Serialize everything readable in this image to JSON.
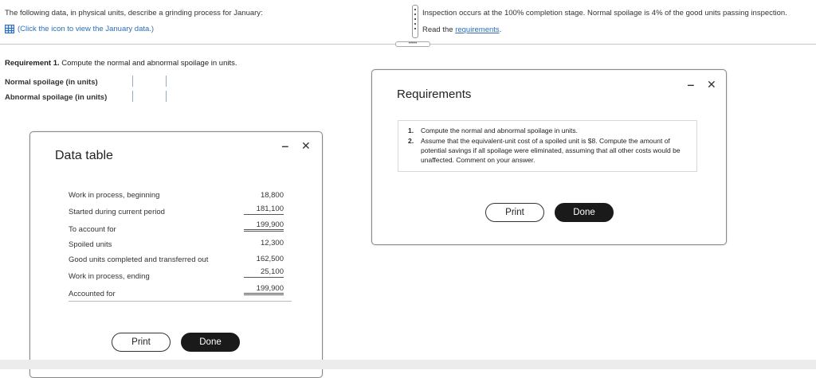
{
  "problem": {
    "intro": "The following data, in physical units, describe a grinding process for January:",
    "data_link": "(Click the icon to view the January data.)",
    "inspection": "Inspection occurs at the 100% completion stage. Normal spoilage is 4% of the good units passing inspection.",
    "read_prefix": "Read the ",
    "read_link": "requirements",
    "read_suffix": "."
  },
  "requirement1": {
    "label": "Requirement 1.",
    "text": " Compute the normal and abnormal spoilage in units.",
    "normal_label": "Normal spoilage (in units)",
    "abnormal_label": "Abnormal spoilage (in units)",
    "normal_value": "",
    "abnormal_value": ""
  },
  "data_table": {
    "title": "Data table",
    "rows": [
      {
        "label": "Work in process, beginning",
        "value": "18,800"
      },
      {
        "label": "Started during current period",
        "value": "181,100"
      },
      {
        "label": "To account for",
        "value": "199,900"
      },
      {
        "label": "Spoiled units",
        "value": "12,300"
      },
      {
        "label": "Good units completed and transferred out",
        "value": "162,500"
      },
      {
        "label": "Work in process, ending",
        "value": "25,100"
      },
      {
        "label": "Accounted for",
        "value": "199,900"
      }
    ],
    "print_label": "Print",
    "done_label": "Done"
  },
  "requirements_modal": {
    "title": "Requirements",
    "items": [
      {
        "num": "1.",
        "text": "Compute the normal and abnormal spoilage in units."
      },
      {
        "num": "2.",
        "text": "Assume that the equivalent-unit cost of a spoiled unit is $8. Compute the amount of potential savings if all spoilage were eliminated, assuming that all other costs would be unaffected. Comment on your answer."
      }
    ],
    "print_label": "Print",
    "done_label": "Done"
  },
  "icons": {
    "minimize": "minimize-icon",
    "close": "close-icon",
    "data": "table-grid-icon"
  }
}
